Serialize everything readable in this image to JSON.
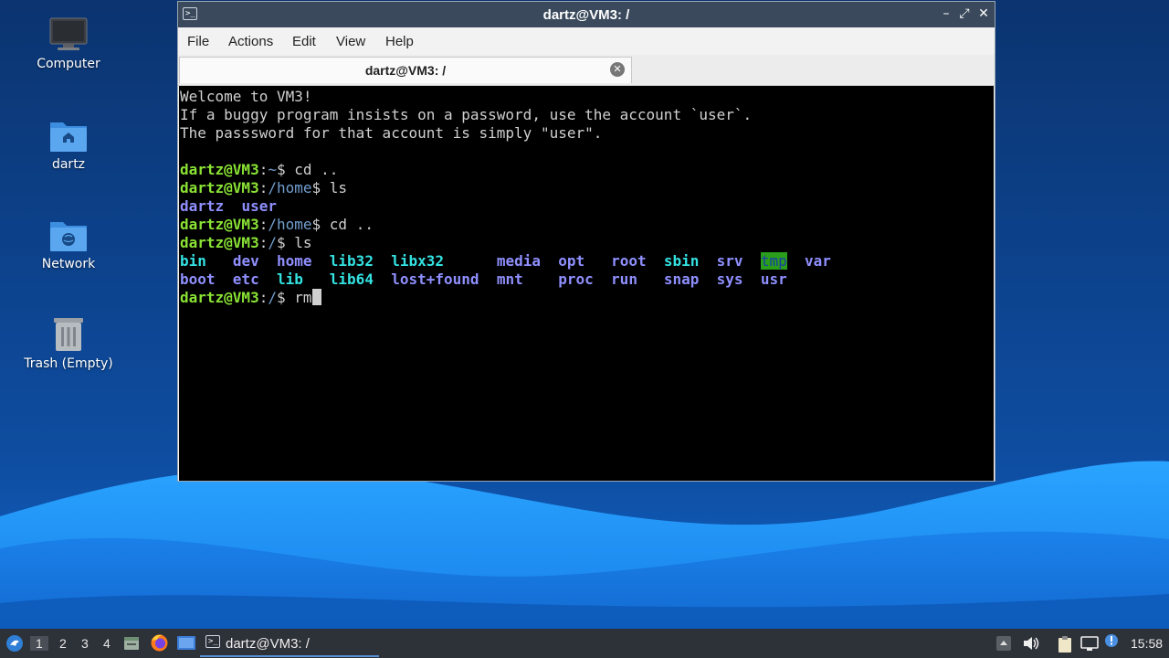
{
  "desktop": {
    "icons": [
      {
        "label": "Computer"
      },
      {
        "label": "dartz"
      },
      {
        "label": "Network"
      },
      {
        "label": "Trash (Empty)"
      }
    ]
  },
  "window": {
    "title": "dartz@VM3: /",
    "controls": {
      "minimize": "–",
      "maximize": "⤢",
      "close": "✕"
    },
    "menu": [
      "File",
      "Actions",
      "Edit",
      "View",
      "Help"
    ],
    "tab": {
      "title": "dartz@VM3: /",
      "close": "✕"
    }
  },
  "terminal": {
    "motd": [
      "Welcome to VM3!",
      "If a buggy program insists on a password, use the account `user`.",
      "The passsword for that account is simply \"user\"."
    ],
    "prompt_user": "dartz@VM3",
    "cmd1": {
      "path": "~",
      "cmd": " cd .."
    },
    "cmd2": {
      "path": "/home",
      "cmd": " ls"
    },
    "ls_home": [
      "dartz",
      "user"
    ],
    "cmd3": {
      "path": "/home",
      "cmd": " cd .."
    },
    "cmd4": {
      "path": "/",
      "cmd": " ls"
    },
    "ls_root_row1": [
      "bin",
      "dev",
      "home",
      "lib32",
      "libx32",
      "media",
      "opt",
      "root",
      "sbin",
      "srv",
      "tmp",
      "var"
    ],
    "ls_root_row2": [
      "boot",
      "etc",
      "lib",
      "lib64",
      "lost+found",
      "mnt",
      "proc",
      "run",
      "snap",
      "sys",
      "usr"
    ],
    "cmd5": {
      "path": "/",
      "cmd": " rm"
    }
  },
  "taskbar": {
    "workspaces": [
      "1",
      "2",
      "3",
      "4"
    ],
    "active_task": "dartz@VM3: /",
    "clock": "15:58"
  },
  "colors": {
    "prompt_user": "#8ae234",
    "prompt_path": "#729fcf",
    "dir": "#8f8fff",
    "link": "#34e2e2",
    "titlebar": "#3a4a5c",
    "taskbar": "#2d3138"
  }
}
